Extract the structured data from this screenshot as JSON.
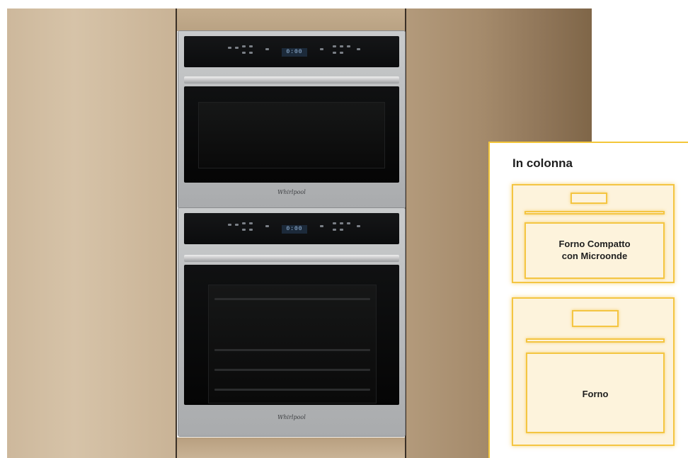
{
  "scene": {
    "description_visible_brand": "Whirlpool",
    "top_oven": {
      "brand": "Whirlpool",
      "display": "0:00"
    },
    "bottom_oven": {
      "brand": "Whirlpool",
      "display": "0:00"
    }
  },
  "legend": {
    "title": "In colonna",
    "top_box_label_line1": "Forno Compatto",
    "top_box_label_line2": "con Microonde",
    "bottom_box_label": "Forno"
  },
  "colors": {
    "accent": "#f4c542",
    "box_fill": "#fdf3dc"
  }
}
